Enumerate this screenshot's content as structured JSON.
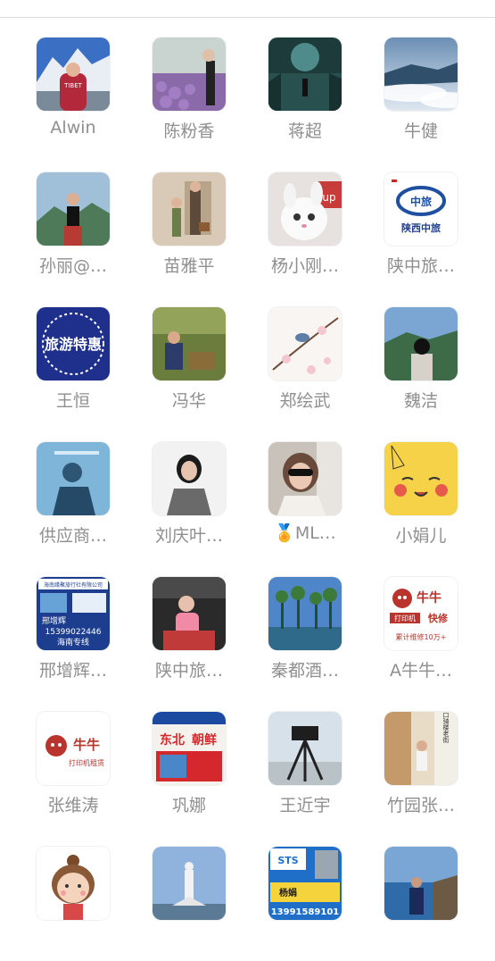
{
  "contacts": [
    {
      "name": "Alwin",
      "avatar": "mountain-man"
    },
    {
      "name": "陈粉香",
      "avatar": "flower-field-woman"
    },
    {
      "name": "蒋超",
      "avatar": "dark-forest-figure"
    },
    {
      "name": "牛健",
      "avatar": "sea-of-clouds"
    },
    {
      "name": "孙丽@…",
      "avatar": "mountain-woman"
    },
    {
      "name": "苗雅平",
      "avatar": "couple-doorway"
    },
    {
      "name": "杨小刚…",
      "avatar": "white-cat"
    },
    {
      "name": "陕中旅…",
      "avatar": "shaanxi-travel-logo",
      "text": [
        "陕西中旅"
      ]
    },
    {
      "name": "王恒",
      "avatar": "travel-deal-badge",
      "text": [
        "旅游特惠"
      ]
    },
    {
      "name": "冯华",
      "avatar": "man-in-park"
    },
    {
      "name": "郑绘武",
      "avatar": "blossom-bird"
    },
    {
      "name": "魏洁",
      "avatar": "woman-lake-view"
    },
    {
      "name": "供应商…",
      "avatar": "man-blue-tint"
    },
    {
      "name": "刘庆叶…",
      "avatar": "woman-portrait"
    },
    {
      "name": "🏅ML…",
      "avatar": "woman-sunglasses"
    },
    {
      "name": "小娟儿",
      "avatar": "pikachu"
    },
    {
      "name": "邢增辉…",
      "avatar": "hainan-travel-card",
      "text": [
        "海南缘聚旅行社有限公司",
        "邢增辉",
        "15399022446",
        "海南专线"
      ]
    },
    {
      "name": "陕中旅…",
      "avatar": "child-in-car"
    },
    {
      "name": "秦都酒…",
      "avatar": "palm-trees"
    },
    {
      "name": "A牛牛…",
      "avatar": "niuniu-logo-kuaiyin",
      "text": [
        "牛牛",
        "打印机",
        "快修",
        "累计维修10万+"
      ]
    },
    {
      "name": "张维涛",
      "avatar": "niuniu-logo",
      "text": [
        "牛牛",
        "打印机租赁"
      ]
    },
    {
      "name": "巩娜",
      "avatar": "northeast-korea-ad",
      "text": [
        "东北",
        "朝鲜"
      ]
    },
    {
      "name": "王近宇",
      "avatar": "tripod-camera"
    },
    {
      "name": "竹园张…",
      "avatar": "street-girl",
      "text": [
        "海口骑楼老街"
      ]
    },
    {
      "name": "",
      "avatar": "cartoon-girl"
    },
    {
      "name": "",
      "avatar": "guanyin-statue"
    },
    {
      "name": "",
      "avatar": "sts-card",
      "text": [
        "STS",
        "杨娟",
        "13991589101"
      ]
    },
    {
      "name": "",
      "avatar": "man-by-sea"
    }
  ],
  "colors": {
    "name_text": "#8f8f8f",
    "divider": "#dcdcdc",
    "background": "#ffffff"
  }
}
